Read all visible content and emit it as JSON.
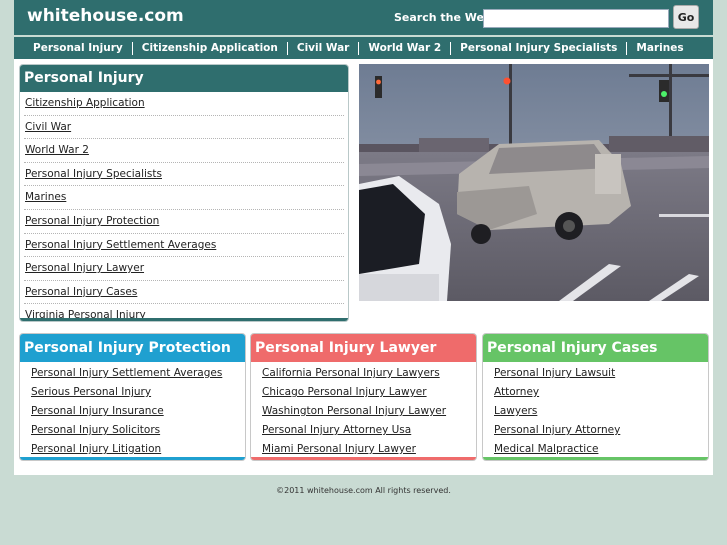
{
  "header": {
    "brand": "whitehouse.com",
    "search_label": "Search the Web:",
    "search_value": "",
    "go_label": "Go"
  },
  "nav": {
    "items": [
      "Personal Injury",
      "Citizenship Application",
      "Civil War",
      "World War 2",
      "Personal Injury Specialists",
      "Marines"
    ]
  },
  "main_panel": {
    "title": "Personal Injury",
    "links": [
      "Citizenship Application",
      "Civil War",
      "World War 2",
      "Personal Injury Specialists",
      "Marines",
      "Personal Injury Protection",
      "Personal Injury Settlement Averages",
      "Personal Injury Lawyer",
      "Personal Injury Cases",
      "Virginia Personal Injury"
    ]
  },
  "boxes": [
    {
      "title": "Personal Injury Protection",
      "color": "#1fa0d0",
      "links": [
        "Personal Injury Settlement Averages",
        "Serious Personal Injury",
        "Personal Injury Insurance",
        "Personal Injury Solicitors",
        "Personal Injury Litigation"
      ]
    },
    {
      "title": "Personal Injury Lawyer",
      "color": "#ef6b6b",
      "links": [
        "California Personal Injury Lawyers",
        "Chicago Personal Injury Lawyer",
        "Washington Personal Injury Lawyer",
        "Personal Injury Attorney Usa",
        "Miami Personal Injury Lawyer"
      ]
    },
    {
      "title": "Personal Injury Cases",
      "color": "#66c466",
      "links": [
        "Personal Injury Lawsuit",
        "Attorney",
        "Lawyers",
        "Personal Injury Attorney",
        "Medical Malpractice"
      ]
    }
  ],
  "colors": {
    "header": "#2f6e6e",
    "page_background": "#c9dbd3"
  },
  "footer": {
    "text": "©2011 whitehouse.com All rights reserved."
  }
}
